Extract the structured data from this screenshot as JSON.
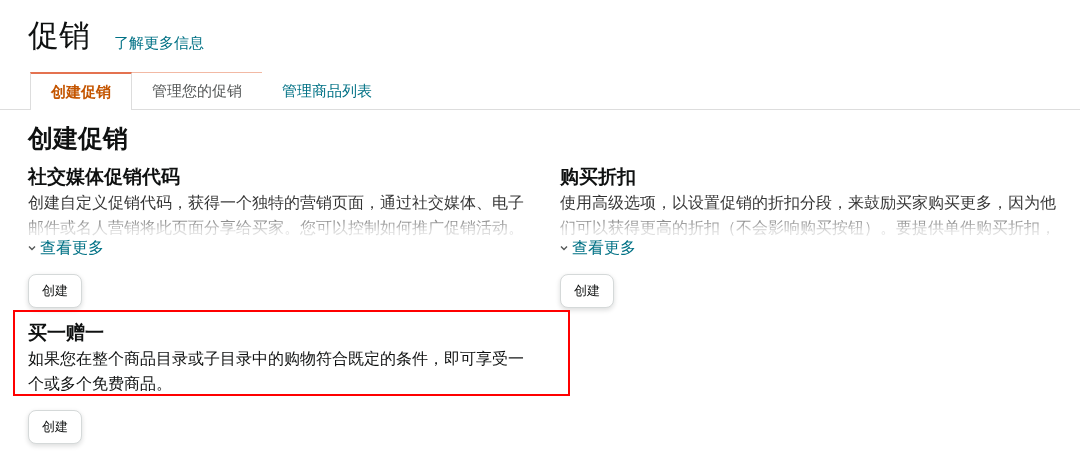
{
  "header": {
    "title": "促销",
    "link": "了解更多信息"
  },
  "tabs": [
    {
      "label": "创建促销",
      "selected": true
    },
    {
      "label": "管理您的促销",
      "selected": false
    },
    {
      "label": "管理商品列表",
      "selected": false
    }
  ],
  "section_title": "创建促销",
  "cards": [
    {
      "title": "社交媒体促销代码",
      "description": "创建自定义促销代码，获得一个独特的营销页面，通过社交媒体、电子邮件或名人营销将此页面分享给买家。您可以控制如何推广促销活动。",
      "collapsed": true,
      "more": "查看更多",
      "button": "创建"
    },
    {
      "title": "购买折扣",
      "description": "使用高级选项，以设置促销的折扣分段，来鼓励买家购买更多，因为他们可以获得更高的折扣（不会影响购买按钮）。要提供单件购买折扣，",
      "collapsed": true,
      "more": "查看更多",
      "button": "创建"
    },
    {
      "title": "买一赠一",
      "description": "如果您在整个商品目录或子目录中的购物符合既定的条件，即可享受一个或多个免费商品。",
      "collapsed": false,
      "button": "创建",
      "highlighted": true
    }
  ]
}
